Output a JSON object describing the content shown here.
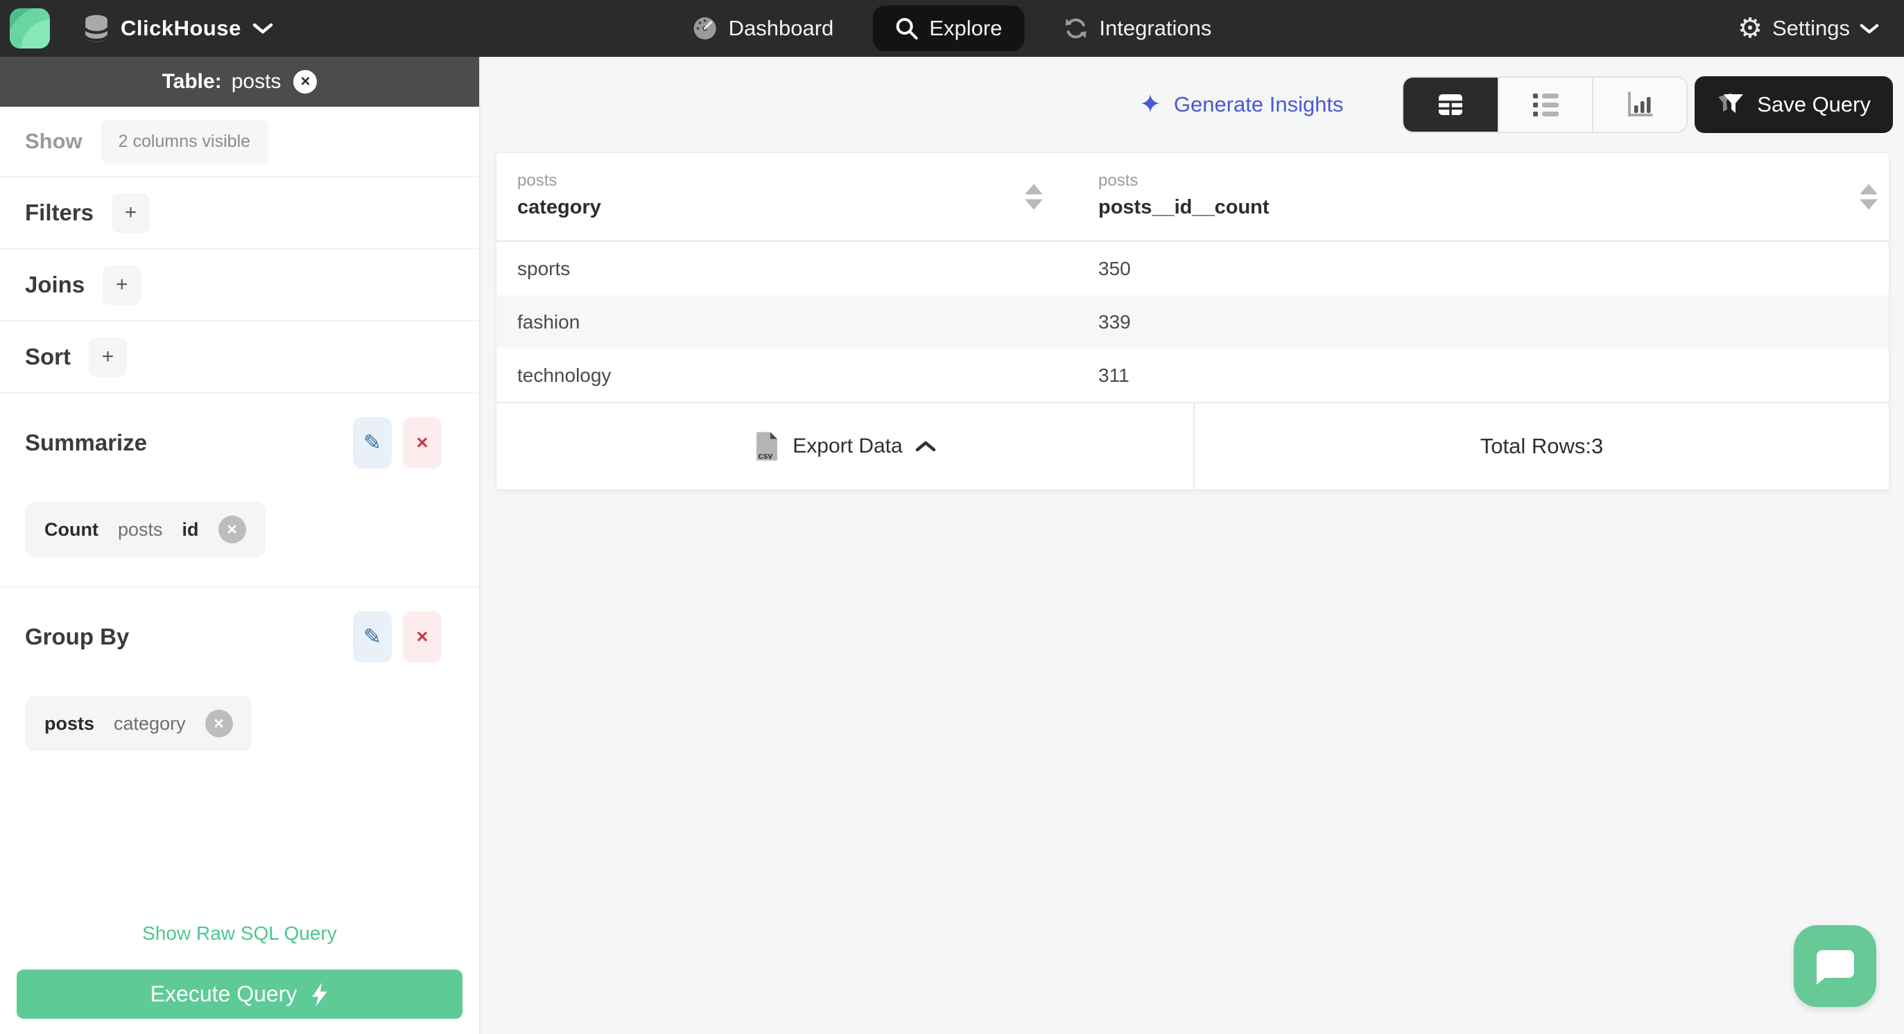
{
  "navbar": {
    "brand": {
      "name": "ClickHouse"
    },
    "items": [
      {
        "label": "Dashboard",
        "icon": "gauge-icon",
        "active": false
      },
      {
        "label": "Explore",
        "icon": "search-icon",
        "active": true
      },
      {
        "label": "Integrations",
        "icon": "sync-icon",
        "active": false
      }
    ],
    "settings": {
      "label": "Settings",
      "icon": "gear-icon"
    }
  },
  "sidebar": {
    "table_header": {
      "prefix": "Table:",
      "table_name": "posts"
    },
    "show": {
      "label": "Show",
      "summary": "2 columns visible"
    },
    "sections": [
      {
        "label": "Filters",
        "add": "+"
      },
      {
        "label": "Joins",
        "add": "+"
      },
      {
        "label": "Sort",
        "add": "+"
      }
    ],
    "summarize": {
      "label": "Summarize",
      "chip": {
        "agg": "Count",
        "table": "posts",
        "column": "id"
      }
    },
    "group_by": {
      "label": "Group By",
      "chip": {
        "table": "posts",
        "column": "category"
      }
    },
    "raw_sql_link": "Show Raw SQL Query",
    "execute_button": "Execute Query"
  },
  "main": {
    "generate_insights": "Generate Insights",
    "save_query": "Save Query",
    "table": {
      "columns": [
        {
          "group": "posts",
          "name": "category"
        },
        {
          "group": "posts",
          "name": "posts__id__count"
        }
      ],
      "rows": [
        [
          "sports",
          "350"
        ],
        [
          "fashion",
          "339"
        ],
        [
          "technology",
          "311"
        ]
      ]
    },
    "footer": {
      "export_label": "Export Data",
      "csv_badge": "csv",
      "total_rows_label": "Total Rows:3"
    }
  },
  "icons": {
    "close": "×",
    "chip_close": "×",
    "pencil": "✎",
    "delete_x": "×",
    "sparkle": "✦",
    "gear": "⚙"
  },
  "colors": {
    "accent_green": "#5ecb97",
    "accent_indigo": "#4a59d1",
    "navbar_bg": "#2b2b2b",
    "danger_red": "#cd3745",
    "edit_blue": "#2e6da4",
    "sidebar_header_bg": "#4c4c4c"
  }
}
